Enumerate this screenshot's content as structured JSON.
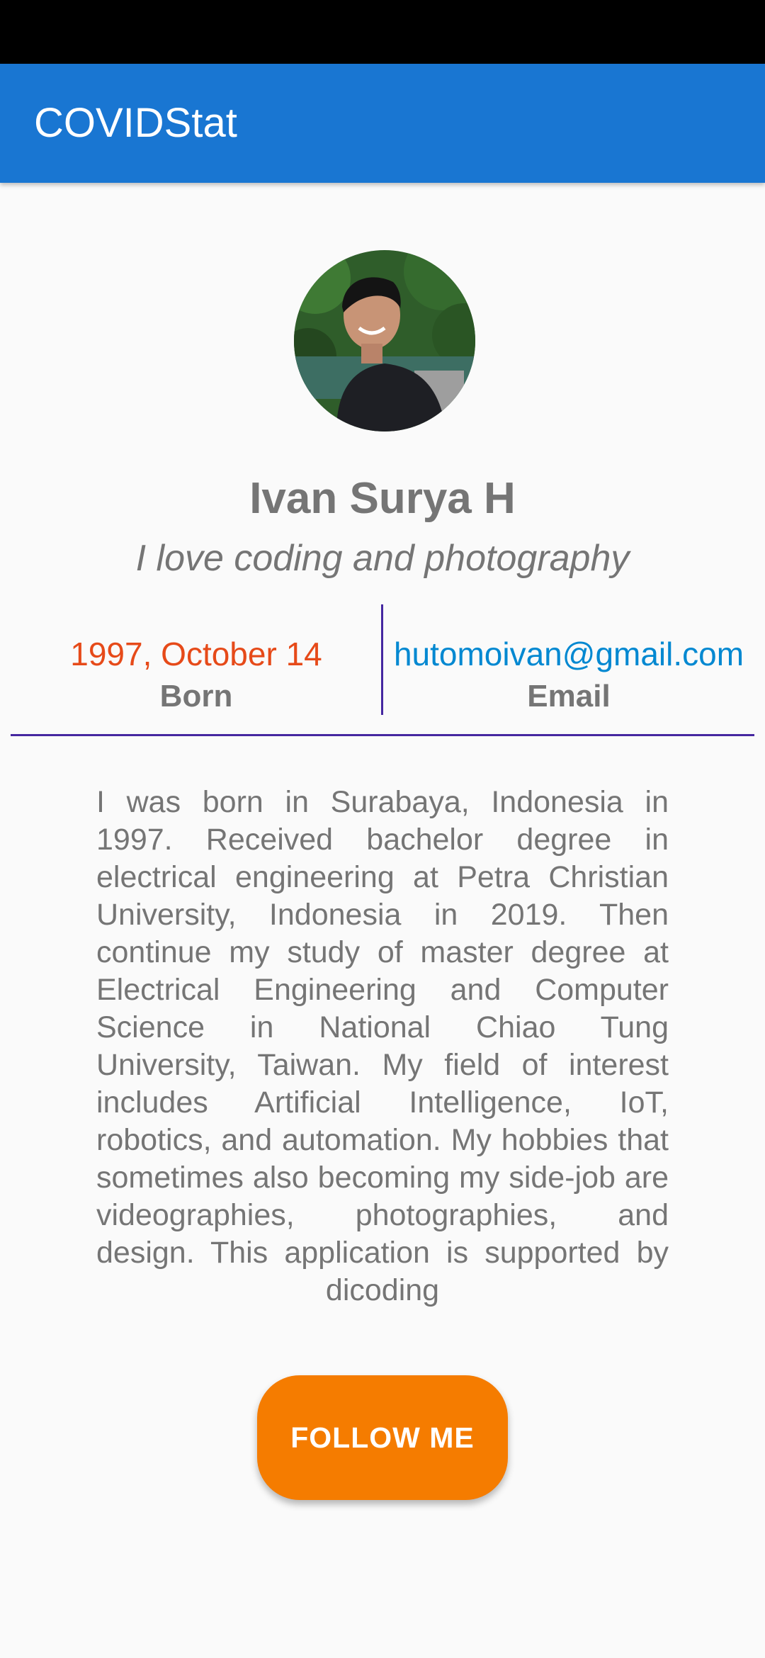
{
  "app": {
    "title": "COVIDStat"
  },
  "profile": {
    "name": "Ivan Surya H",
    "tagline": "I love coding and photography",
    "avatar_alt": "profile-photo"
  },
  "info": {
    "born_value": "1997, October 14",
    "born_label": "Born",
    "email_value": "hutomoivan@gmail.com",
    "email_label": "Email"
  },
  "bio": "I was born in Surabaya, Indonesia in 1997. Received bachelor degree in electrical engineering at Petra Christian University, Indonesia in 2019. Then continue my study of master degree at Electrical Engineering and Computer Science in National Chiao Tung University, Taiwan. My field of interest includes Artificial Intelligence, IoT, robotics, and automation. My hobbies that sometimes also becoming my side-job are videographies, photographies, and design. This application is supported by dicoding",
  "actions": {
    "follow_label": "FOLLOW ME"
  },
  "colors": {
    "app_bar": "#1976d2",
    "born_text": "#e64a19",
    "email_text": "#0288d1",
    "divider": "#4527a0",
    "button": "#f57c00",
    "secondary_text": "#757575"
  }
}
